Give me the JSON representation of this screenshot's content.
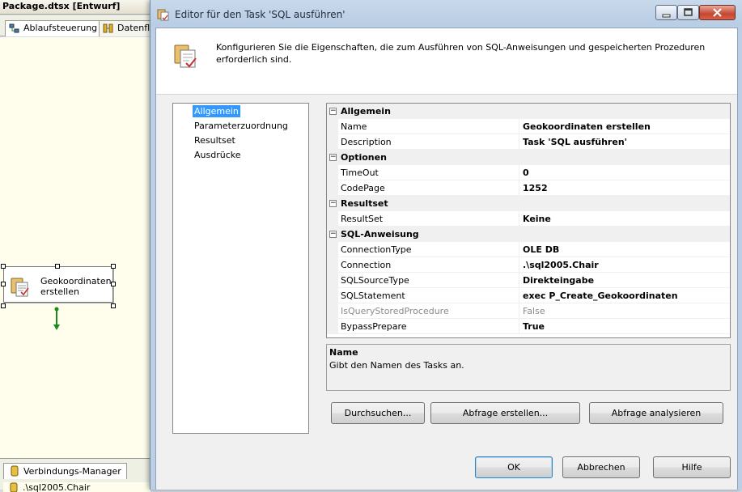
{
  "background": {
    "window_title": "Package.dtsx [Entwurf]",
    "tabs": [
      {
        "label": "Ablaufsteuerung",
        "icon": "control-flow-icon"
      },
      {
        "label": "Datenflu",
        "icon": "data-flow-icon"
      }
    ],
    "task": {
      "label_line1": "Geokoordinaten",
      "label_line2": "erstellen",
      "icon": "sql-task-icon"
    },
    "connection_manager_tab": "Verbindungs-Manager",
    "connection_item": ".\\sql2005.Chair"
  },
  "dialog": {
    "title": "Editor für den Task 'SQL ausführen'",
    "header_description": "Konfigurieren Sie die Eigenschaften, die zum Ausführen von SQL-Anweisungen und gespeicherten Prozeduren erforderlich sind.",
    "nav_items": [
      {
        "label": "Allgemein",
        "selected": true
      },
      {
        "label": "Parameterzuordnung",
        "selected": false
      },
      {
        "label": "Resultset",
        "selected": false
      },
      {
        "label": "Ausdrücke",
        "selected": false
      }
    ],
    "property_grid": {
      "categories": [
        {
          "name": "Allgemein",
          "toggle": "⊟",
          "rows": [
            {
              "name": "Name",
              "value": "Geokoordinaten erstellen",
              "disabled": false
            },
            {
              "name": "Description",
              "value": "Task 'SQL ausführen'",
              "disabled": false
            }
          ]
        },
        {
          "name": "Optionen",
          "toggle": "⊟",
          "rows": [
            {
              "name": "TimeOut",
              "value": "0",
              "disabled": false
            },
            {
              "name": "CodePage",
              "value": "1252",
              "disabled": false
            }
          ]
        },
        {
          "name": "Resultset",
          "toggle": "⊟",
          "rows": [
            {
              "name": "ResultSet",
              "value": "Keine",
              "disabled": false
            }
          ]
        },
        {
          "name": "SQL-Anweisung",
          "toggle": "⊟",
          "rows": [
            {
              "name": "ConnectionType",
              "value": "OLE DB",
              "disabled": false
            },
            {
              "name": "Connection",
              "value": ".\\sql2005.Chair",
              "disabled": false
            },
            {
              "name": "SQLSourceType",
              "value": "Direkteingabe",
              "disabled": false
            },
            {
              "name": "SQLStatement",
              "value": "exec P_Create_Geokoordinaten",
              "disabled": false
            },
            {
              "name": "IsQueryStoredProcedure",
              "value": "False",
              "disabled": true
            },
            {
              "name": "BypassPrepare",
              "value": "True",
              "disabled": false
            }
          ]
        }
      ]
    },
    "help": {
      "title": "Name",
      "text": "Gibt den Namen des Tasks an."
    },
    "buttons": {
      "browse": "Durchsuchen...",
      "build_query": "Abfrage erstellen...",
      "parse_query": "Abfrage analysieren",
      "ok": "OK",
      "cancel": "Abbrechen",
      "help": "Hilfe"
    },
    "caption_buttons": {
      "minimize": "minimize-icon",
      "maximize": "maximize-icon",
      "close": "close-icon"
    }
  }
}
